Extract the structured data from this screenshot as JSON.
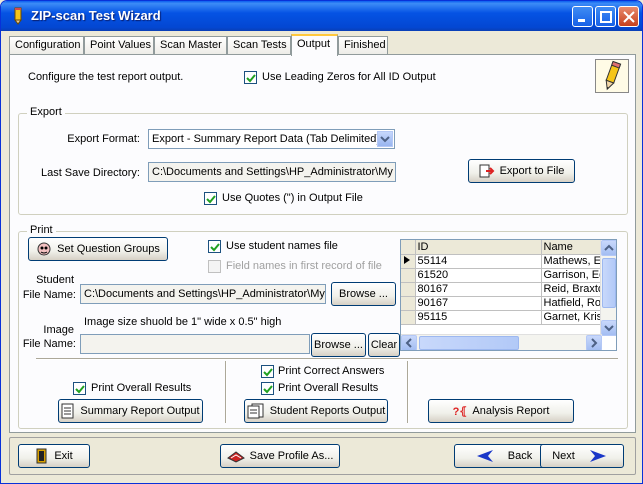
{
  "window": {
    "title": "ZIP-scan Test Wizard"
  },
  "tabs": [
    {
      "label": "Configuration"
    },
    {
      "label": "Point Values"
    },
    {
      "label": "Scan Master"
    },
    {
      "label": "Scan Tests"
    },
    {
      "label": "Output",
      "active": true
    },
    {
      "label": "Finished"
    }
  ],
  "header": {
    "description": "Configure the test report output.",
    "leading_zeros_label": "Use Leading Zeros for All ID Output",
    "leading_zeros_checked": true
  },
  "export": {
    "group_title": "Export",
    "format_label": "Export Format:",
    "format_value": "Export - Summary Report Data (Tab Delimited)",
    "last_dir_label": "Last Save Directory:",
    "last_dir_value": "C:\\Documents and Settings\\HP_Administrator\\My",
    "export_button": "Export to File",
    "use_quotes_label": "Use Quotes (\") in Output File",
    "use_quotes_checked": true
  },
  "print": {
    "group_title": "Print",
    "set_groups_button": "Set Question Groups",
    "use_names_label": "Use student names file",
    "use_names_checked": true,
    "field_names_label": "Field names in first record of file",
    "field_names_checked": false,
    "student_file_label_1": "Student",
    "student_file_label_2": "File Name:",
    "student_file_value": "C:\\Documents and Settings\\HP_Administrator\\My",
    "browse_label": "Browse ...",
    "image_hint": "Image size shuold be 1\" wide x 0.5\" high",
    "image_file_label_1": "Image",
    "image_file_label_2": "File Name:",
    "image_file_value": "",
    "clear_label": "Clear",
    "grid": {
      "columns": [
        "ID",
        "Name"
      ],
      "rows": [
        {
          "id": "55114",
          "name": "Mathews, E",
          "current": true
        },
        {
          "id": "61520",
          "name": "Garrison, Ed"
        },
        {
          "id": "80167",
          "name": "Reid, Braxto"
        },
        {
          "id": "90167",
          "name": "Hatfield, Ro"
        },
        {
          "id": "95115",
          "name": "Garnet, Kris"
        }
      ]
    },
    "summary": {
      "overall_label": "Print Overall Results",
      "overall_checked": true,
      "button": "Summary Report Output"
    },
    "student": {
      "correct_label": "Print Correct Answers",
      "correct_checked": true,
      "overall_label": "Print Overall Results",
      "overall_checked": true,
      "button": "Student Reports Output"
    },
    "analysis": {
      "button": "Analysis Report"
    }
  },
  "footer": {
    "exit": "Exit",
    "save_profile": "Save Profile As...",
    "back": "Back",
    "next": "Next"
  },
  "colors": {
    "titlebar": "#0553e4",
    "accent_tab": "#ffc83c",
    "arrow_blue": "#1a37c8"
  }
}
